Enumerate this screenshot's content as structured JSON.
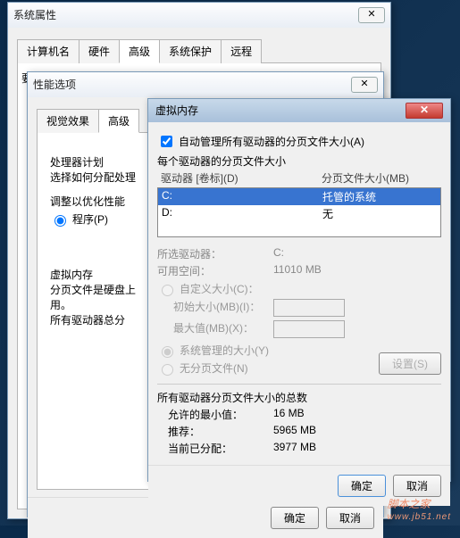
{
  "sysprop": {
    "title": "系统属性",
    "tabs": [
      "计算机名",
      "硬件",
      "高级",
      "系统保护",
      "远程"
    ],
    "active_tab": 2,
    "text_cut": "要进行大多数更改，你必须作为管理员登录"
  },
  "perf": {
    "title": "性能选项",
    "tabs": [
      "视觉效果",
      "高级"
    ],
    "active_tab": 1,
    "section_cpu": "处理器计划",
    "cpu_desc": "选择如何分配处理",
    "adjust": "调整以优化性能",
    "rad_programs": "程序(P)",
    "section_vm": "虚拟内存",
    "vm_desc": "分页文件是硬盘上",
    "vm_desc2": "用。",
    "total_all": "所有驱动器总分",
    "ok": "确定",
    "cancel": "取消"
  },
  "vm": {
    "title": "虚拟内存",
    "auto_chk": "自动管理所有驱动器的分页文件大小(A)",
    "list_title": "每个驱动器的分页文件大小",
    "hdr_drive": "驱动器 [卷标](D)",
    "hdr_size": "分页文件大小(MB)",
    "rows": [
      {
        "drive": "C:",
        "size": "托管的系统",
        "sel": true
      },
      {
        "drive": "D:",
        "size": "无",
        "sel": false
      }
    ],
    "sel_drive_lbl": "所选驱动器：",
    "sel_drive_val": "C:",
    "free_lbl": "可用空间：",
    "free_val": "11010 MB",
    "rad_custom": "自定义大小(C)：",
    "init_lbl": "初始大小(MB)(I)：",
    "max_lbl": "最大值(MB)(X)：",
    "rad_sys": "系统管理的大小(Y)",
    "rad_none": "无分页文件(N)",
    "btn_set": "设置(S)",
    "totals_title": "所有驱动器分页文件大小的总数",
    "min_lbl": "允许的最小值：",
    "min_val": "16 MB",
    "rec_lbl": "推荐：",
    "rec_val": "5965 MB",
    "cur_lbl": "当前已分配：",
    "cur_val": "3977 MB",
    "ok": "确定",
    "cancel": "取消"
  },
  "watermark": {
    "brand": "脚本之家",
    "url": "www.jb51.net"
  }
}
